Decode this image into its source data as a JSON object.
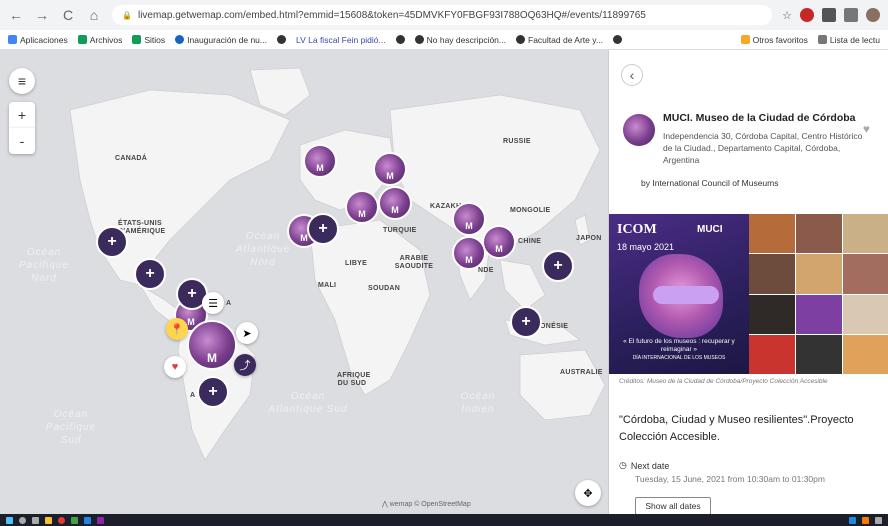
{
  "browser": {
    "back": "←",
    "forward": "→",
    "reload": "C",
    "home": "⌂",
    "url": "livemap.getwemap.com/embed.html?emmid=15608&token=45DMVKFY0FBGF93I788OQ63HQ#/events/11899765",
    "star": "☆",
    "bookmarks": [
      {
        "label": "Aplicaciones",
        "color": "#4285f4"
      },
      {
        "label": "Archivos",
        "color": "#0f9d58"
      },
      {
        "label": "Sitios",
        "color": "#0f9d58"
      },
      {
        "label": "Inauguración de nu...",
        "color": "#1565c0"
      },
      {
        "label": "",
        "color": "#333"
      },
      {
        "label": "LV  La fiscal Fein pidió...",
        "color": "#3949ab"
      },
      {
        "label": "",
        "color": "#333"
      },
      {
        "label": "No hay descripción...",
        "color": "#333"
      },
      {
        "label": "Facultad de Arte y...",
        "color": "#333"
      },
      {
        "label": "",
        "color": "#333"
      }
    ],
    "other_favorites": "Otros favoritos",
    "reading_list": "Lista de lectu"
  },
  "map": {
    "menu_icon": "≡",
    "zoom_in": "+",
    "zoom_out": "-",
    "cluster_symbol": "+",
    "logo_letter": "M",
    "labels": {
      "canada": "CANADÁ",
      "usa": "ÉTATS-UNIS D'AMÉRIQUE",
      "russie": "RUSSIE",
      "kazakh": "KAZAKH",
      "mongolie": "MONGOLIE",
      "turquie": "TURQUIE",
      "chine": "CHINE",
      "japon": "JAPON",
      "libye": "LIBYE",
      "arabie": "ARABIE SAOUDITE",
      "mali": "MALI",
      "soudan": "SOUDAN",
      "inde": "NDE",
      "indonesie": "ONÉSIE",
      "afrique": "AFRIQUE DU SUD",
      "australie": "AUSTRALIE",
      "peru": "A",
      "ar": "A"
    },
    "oceans": {
      "pacific_north": "Océan Pacifique Nord",
      "atlantic_north": "Océan Atlantique Nord",
      "atlantic_south": "Océan Atlantique Sud",
      "pacific_south": "Océan Pacifique Sud",
      "indian": "Océan Indien"
    },
    "attribution": "⋀ wemap    © OpenStreetMap"
  },
  "panel": {
    "back_icon": "‹",
    "venue_name": "MUCI. Museo de la Ciudad de Córdoba",
    "heart": "♥",
    "address": "Independencia 30, Córdoba Capital, Centro Histórico de la Ciudad., Departamento Capital, Córdoba, Argentina",
    "by": "by International Council of Museums",
    "poster": {
      "icom": "ICOM",
      "muci": "MUCI",
      "date": "18 mayo 2021",
      "caption": "« El futuro de los museos : recuperar y reimaginar »",
      "sub": "DÍA INTERNACIONAL DE LOS MUSEOS"
    },
    "credit": "Créditos: Museo de la Ciudad de Córdoba/Proyecto Colección Accesible",
    "event_title": "\"Córdoba, Ciudad y Museo resilientes\".Proyecto Colección Accesible.",
    "next_date_label": "Next date",
    "next_date_value": "Tuesday, 15 June, 2021 from 10:30am to 01:30pm",
    "show_all": "Show all dates"
  }
}
